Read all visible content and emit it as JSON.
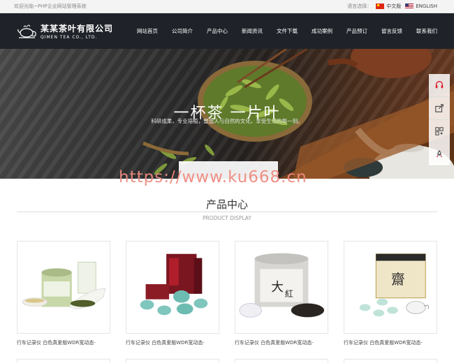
{
  "topbar": {
    "welcome": "欢迎光临~PHP企业网站管理系统",
    "lang_label": "语言选择：",
    "lang_cn": "中文版",
    "lang_en": "ENGLISH"
  },
  "brand": {
    "name_cn": "某某茶叶有限公司",
    "name_en": "QIMEN TEA CO., LTD."
  },
  "menu": [
    {
      "label": "网站首页"
    },
    {
      "label": "公司简介"
    },
    {
      "label": "产品中心"
    },
    {
      "label": "新闻资讯"
    },
    {
      "label": "文件下载"
    },
    {
      "label": "成功案例"
    },
    {
      "label": "产品预订"
    },
    {
      "label": "留言反馈"
    },
    {
      "label": "联系我们"
    }
  ],
  "banner": {
    "title": "一杯茶 一片叶",
    "subtitle": "科研成果，专业培植，塑造人与自然的文化，享受生活的每一刻。"
  },
  "sidebar_icons": [
    "headset-icon",
    "share-icon",
    "qrcode-icon",
    "rocket-icon"
  ],
  "watermark": "https://www.ku668.cn",
  "section": {
    "title": "产品中心",
    "subtitle": "PRODUCT DISPLAY"
  },
  "products": [
    {
      "caption": "行车记录仪 白色真爱版WDR宽动态-"
    },
    {
      "caption": "行车记录仪 白色真爱版WDR宽动态-"
    },
    {
      "caption": "行车记录仪 白色真爱版WDR宽动态-"
    },
    {
      "caption": "行车记录仪 白色真爱版WDR宽动态-"
    }
  ],
  "colors": {
    "nav_bg": "#1f2329",
    "watermark": "#f08a80"
  }
}
